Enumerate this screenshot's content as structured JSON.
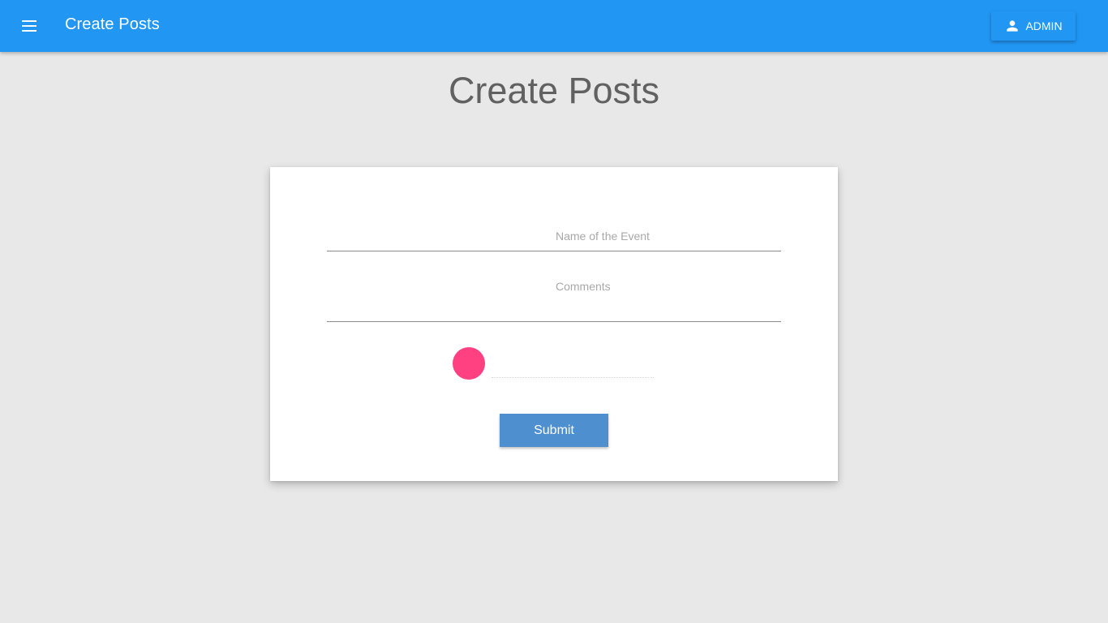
{
  "appbar": {
    "menu_icon": "menu-icon",
    "title": "Create Posts",
    "admin_button": {
      "icon": "person-icon",
      "label": "ADMIN"
    },
    "color": "#2196f3"
  },
  "page": {
    "heading": "Create Posts",
    "background": "#e8e8e8"
  },
  "form": {
    "event_name": {
      "label": "Name of the Event",
      "value": ""
    },
    "comments": {
      "label": "Comments",
      "value": ""
    },
    "color_picker": {
      "swatch_color": "#ff4081",
      "value": ""
    },
    "submit_label": "Submit",
    "submit_color": "#4d8fcf"
  }
}
